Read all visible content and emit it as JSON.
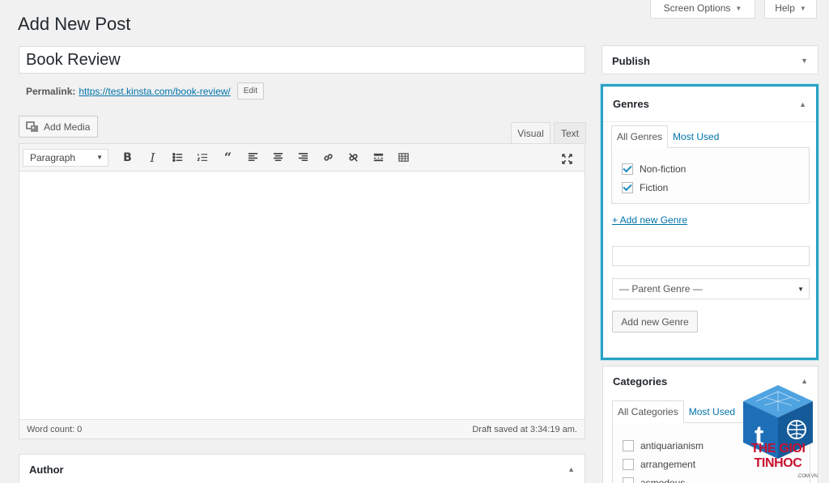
{
  "screen_meta": {
    "screen_options_label": "Screen Options",
    "help_label": "Help"
  },
  "page": {
    "title": "Add New Post"
  },
  "post": {
    "title_value": "Book Review",
    "permalink_label": "Permalink:",
    "permalink_url": "https://test.kinsta.com/book-review/",
    "edit_label": "Edit"
  },
  "editor": {
    "add_media_label": "Add Media",
    "tabs": {
      "visual": "Visual",
      "text": "Text"
    },
    "format_value": "Paragraph",
    "toolbar_icons": [
      "bold-icon",
      "italic-icon",
      "bullet-list-icon",
      "numbered-list-icon",
      "blockquote-icon",
      "align-left-icon",
      "align-center-icon",
      "align-right-icon",
      "link-icon",
      "unlink-icon",
      "read-more-icon",
      "toolbar-toggle-icon",
      "fullscreen-icon"
    ],
    "word_count": "Word count: 0",
    "draft_status": "Draft saved at 3:34:19 am."
  },
  "author_box": {
    "title": "Author"
  },
  "publish_box": {
    "title": "Publish"
  },
  "genres_box": {
    "title": "Genres",
    "tabs": {
      "all": "All Genres",
      "most_used": "Most Used"
    },
    "items": [
      {
        "label": "Non-fiction",
        "checked": true
      },
      {
        "label": "Fiction",
        "checked": true
      }
    ],
    "add_new_link": "+ Add new Genre",
    "new_genre_value": "",
    "parent_select_value": "— Parent Genre —",
    "add_new_button": "Add new Genre"
  },
  "categories_box": {
    "title": "Categories",
    "tabs": {
      "all": "All Categories",
      "most_used": "Most Used"
    },
    "items": [
      {
        "label": "antiquarianism",
        "checked": false
      },
      {
        "label": "arrangement",
        "checked": false
      },
      {
        "label": "asmodeus",
        "checked": false
      }
    ]
  },
  "watermark": {
    "text": "THE GIOI TINHOC",
    "sub": ".COM.VN",
    "colors": {
      "primary": "#1d6fb8",
      "text": "#c8102e"
    }
  },
  "colors": {
    "highlight": "#27a2c4",
    "link": "#0073aa",
    "background": "#f1f1f1"
  }
}
